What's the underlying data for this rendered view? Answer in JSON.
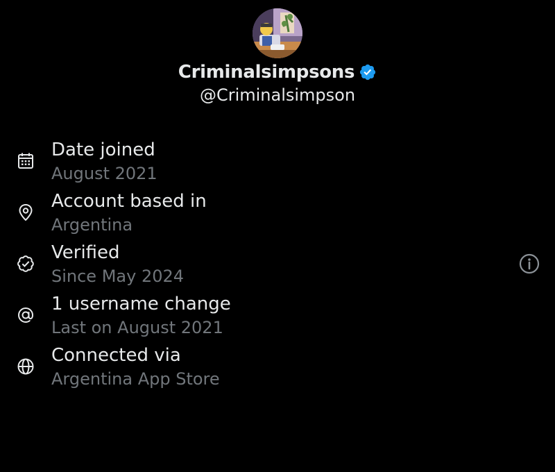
{
  "profile": {
    "display_name": "Criminalsimpsons",
    "handle": "@Criminalsimpson",
    "avatar_icon": "avatar-image",
    "badge_icon": "verified-badge-icon",
    "badge_color": "#1d9bf0"
  },
  "info": {
    "items": [
      {
        "icon": "calendar-icon",
        "label": "Date joined",
        "value": "August 2021"
      },
      {
        "icon": "location-pin-icon",
        "label": "Account based in",
        "value": "Argentina"
      },
      {
        "icon": "verified-check-icon",
        "label": "Verified",
        "value": "Since May 2024"
      },
      {
        "icon": "at-sign-icon",
        "label": "1 username change",
        "value": "Last on August 2021"
      },
      {
        "icon": "globe-icon",
        "label": "Connected via",
        "value": "Argentina App Store"
      }
    ],
    "info_icon": "info-circle-icon"
  },
  "colors": {
    "background": "#000000",
    "primary_text": "#e7e9ea",
    "secondary_text": "#71767b",
    "accent": "#1d9bf0"
  }
}
